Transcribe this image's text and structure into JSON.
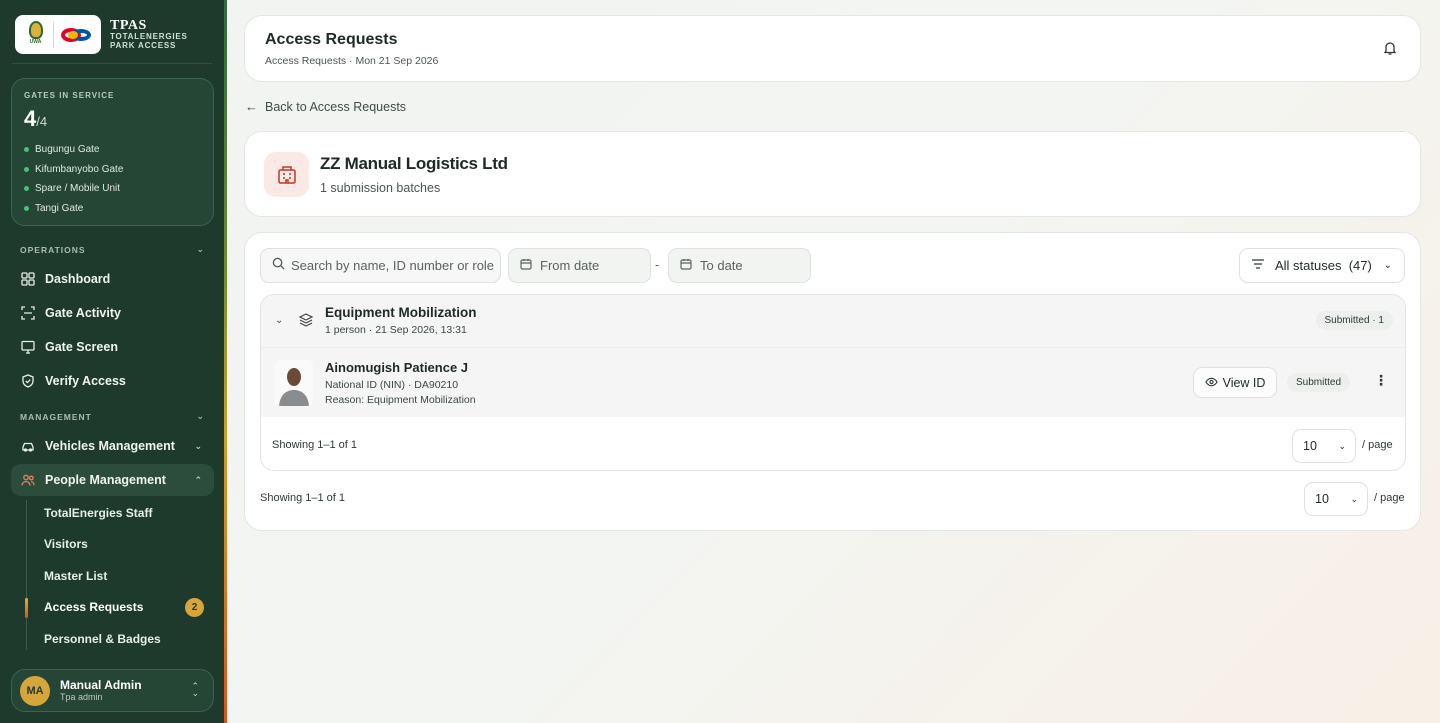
{
  "brand": {
    "uwa_text": "UWA",
    "title": "TPAS",
    "subtitle_line1": "TOTALENERGIES",
    "subtitle_line2": "PARK ACCESS"
  },
  "gates": {
    "label": "GATES IN SERVICE",
    "count": "4",
    "total": "/4",
    "items": [
      "Bugungu Gate",
      "Kifumbanyobo Gate",
      "Spare / Mobile Unit",
      "Tangi Gate"
    ]
  },
  "sidebar": {
    "operations_label": "OPERATIONS",
    "operations": [
      {
        "label": "Dashboard",
        "icon": "dashboard-icon"
      },
      {
        "label": "Gate Activity",
        "icon": "scan-icon"
      },
      {
        "label": "Gate Screen",
        "icon": "monitor-icon"
      },
      {
        "label": "Verify Access",
        "icon": "shield-check-icon"
      }
    ],
    "management_label": "MANAGEMENT",
    "management": [
      {
        "label": "Vehicles Management",
        "icon": "car-icon"
      },
      {
        "label": "People Management",
        "icon": "people-icon"
      }
    ],
    "people_sub": [
      "TotalEnergies Staff",
      "Visitors",
      "Master List",
      "Access Requests",
      "Personnel & Badges"
    ],
    "access_requests_badge": "2"
  },
  "user": {
    "initials": "MA",
    "name": "Manual Admin",
    "role": "Tpa admin"
  },
  "header": {
    "title": "Access Requests",
    "breadcrumb": "Access Requests · Mon 21 Sep 2026"
  },
  "back_link": "Back to Access Requests",
  "company": {
    "name": "ZZ Manual Logistics Ltd",
    "subtitle": "1 submission batches"
  },
  "filters": {
    "search_placeholder": "Search by name, ID number or role",
    "from_date": "From date",
    "to_date": "To date",
    "dash": "-",
    "status": "All statuses",
    "status_count": "(47)"
  },
  "batch": {
    "title": "Equipment Mobilization",
    "meta": "1 person · 21 Sep 2026, 13:31",
    "status_pill": "Submitted · 1",
    "person": {
      "name": "Ainomugish Patience J",
      "id_line": "National ID (NIN) · DA90210",
      "reason": "Reason: Equipment Mobilization",
      "view_label": "View ID",
      "status": "Submitted"
    },
    "showing": "Showing 1–1 of 1",
    "page_size": "10",
    "per_page": "/ page"
  },
  "footer": {
    "showing": "Showing 1–1 of 1",
    "page_size": "10",
    "per_page": "/ page"
  },
  "colors": {
    "sidebar_bg": "#1e3a2c",
    "accent_gold": "#d6a53c",
    "company_icon": "#c0392b"
  }
}
